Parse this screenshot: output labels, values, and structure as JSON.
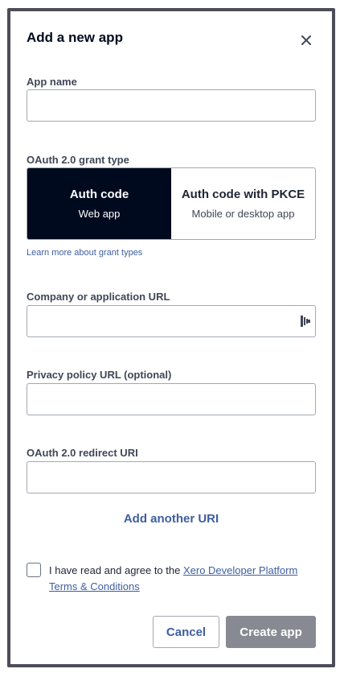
{
  "modal": {
    "title": "Add a new app",
    "close_icon": "close-icon"
  },
  "app_name": {
    "label": "App name",
    "value": "",
    "placeholder": ""
  },
  "grant_type": {
    "label": "OAuth 2.0 grant type",
    "options": [
      {
        "title": "Auth code",
        "subtitle": "Web app",
        "selected": true
      },
      {
        "title": "Auth code with PKCE",
        "subtitle": "Mobile or desktop app",
        "selected": false
      }
    ],
    "learn_more": "Learn more about grant types"
  },
  "company_url": {
    "label": "Company or application URL",
    "value": "",
    "placeholder": "",
    "icon": "password-manager-icon"
  },
  "privacy_url": {
    "label": "Privacy policy URL (optional)",
    "value": "",
    "placeholder": ""
  },
  "redirect_uri": {
    "label": "OAuth 2.0 redirect URI",
    "value": "",
    "placeholder": "",
    "add_another": "Add another URI"
  },
  "terms": {
    "checked": false,
    "prefix": "I have read and agree to the ",
    "link_text": "Xero Developer Platform Terms & Conditions"
  },
  "actions": {
    "cancel": "Cancel",
    "create": "Create app"
  },
  "colors": {
    "selected_bg": "#000a1e",
    "link": "#3e5ea0",
    "disabled_button": "#878a92",
    "border": "#4c4d59"
  }
}
